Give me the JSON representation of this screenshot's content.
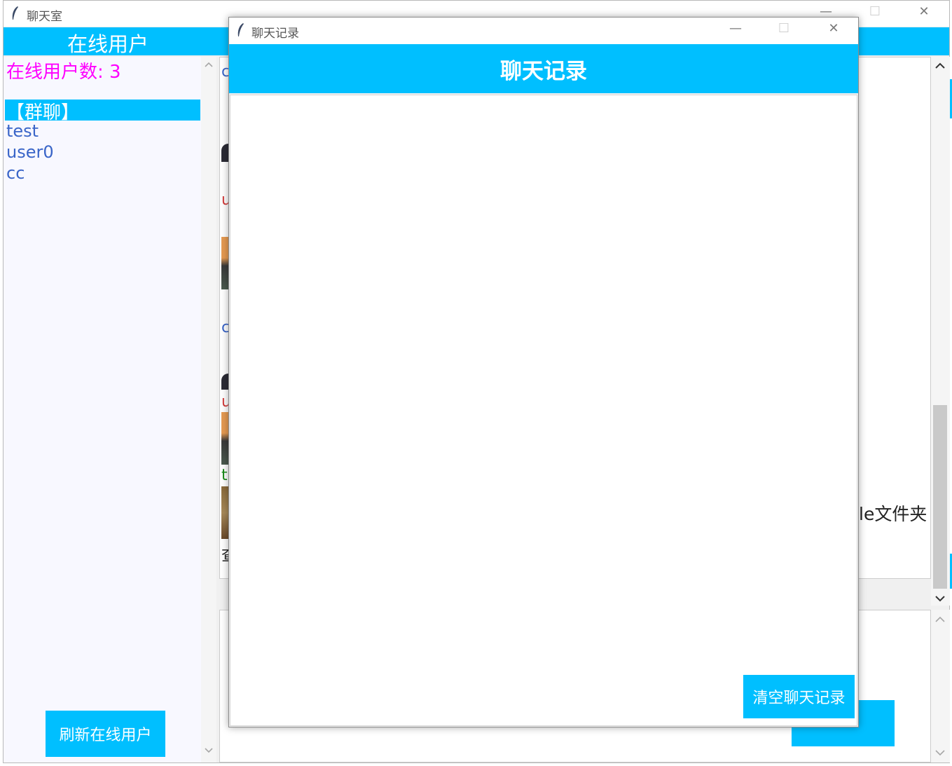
{
  "main_window": {
    "title": "聊天室",
    "controls": {
      "minimize": "—",
      "maximize": "☐",
      "close": "✕"
    }
  },
  "sidebar": {
    "title": "在线用户",
    "count_text": "在线用户数: 3",
    "group_item": "【群聊】",
    "users": [
      "test",
      "user0",
      "cc"
    ],
    "refresh_label": "刷新在线用户"
  },
  "chat": {
    "folder_text": "le文件夹",
    "fragments": {
      "f1": "c",
      "f2": "u",
      "f3": "c",
      "f4": "u",
      "f5": "t",
      "f6": "查"
    }
  },
  "dialog": {
    "title": "聊天记录",
    "header": "聊天记录",
    "clear_label": "清空聊天记录",
    "controls": {
      "minimize": "—",
      "maximize": "☐",
      "close": "✕"
    }
  },
  "colors": {
    "accent": "#00bfff",
    "user_count": "#ff00ff",
    "user_text": "#3a65c8"
  }
}
